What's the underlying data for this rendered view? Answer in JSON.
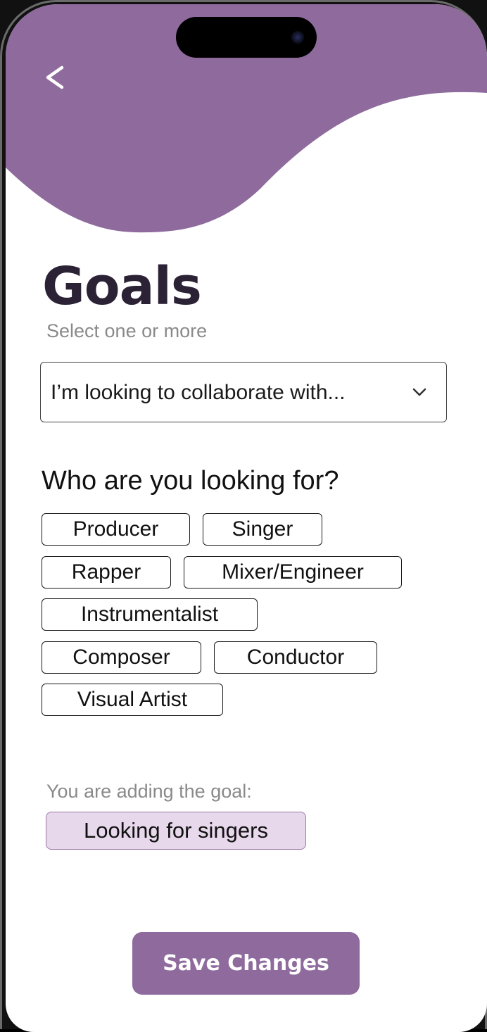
{
  "colors": {
    "accent": "#8E6A9D",
    "title": "#2B2236",
    "muted_text": "#8A8A8A",
    "goal_chip_bg": "#E8D8EC",
    "goal_chip_border": "#9A7AA8"
  },
  "header": {
    "back_icon": "chevron-left-icon"
  },
  "page": {
    "title": "Goals",
    "subtitle": "Select one or more"
  },
  "dropdown": {
    "value": "I’m looking to collaborate with...",
    "icon": "chevron-down-icon"
  },
  "roles": {
    "heading": "Who are you looking for?",
    "options": [
      "Producer",
      "Singer",
      "Rapper",
      "Mixer/Engineer",
      "Instrumentalist",
      "Composer",
      "Conductor",
      "Visual Artist"
    ]
  },
  "goal": {
    "label": "You are adding the goal:",
    "value": "Looking for singers"
  },
  "actions": {
    "save_label": "Save Changes"
  }
}
